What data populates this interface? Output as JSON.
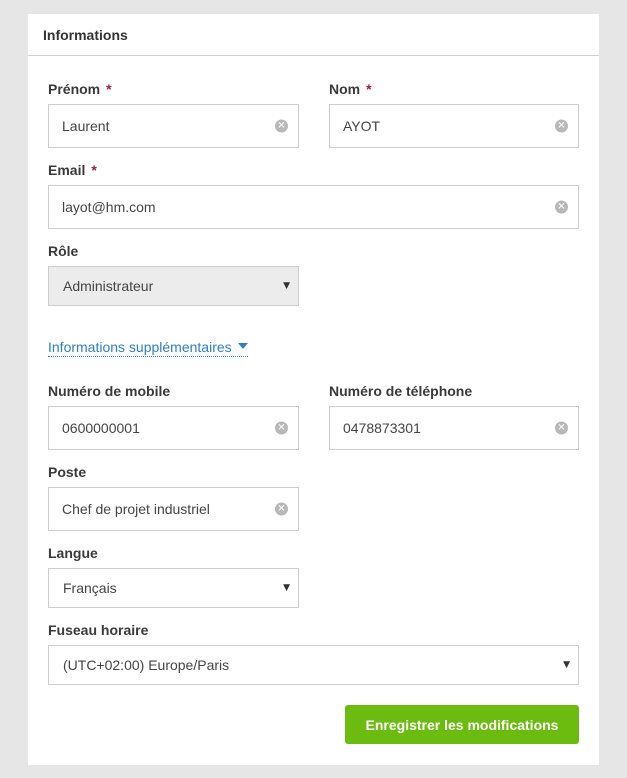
{
  "header": {
    "title": "Informations"
  },
  "required_marker": "*",
  "fields": {
    "prenom": {
      "label": "Prénom",
      "value": "Laurent"
    },
    "nom": {
      "label": "Nom",
      "value": "AYOT"
    },
    "email": {
      "label": "Email",
      "value": "layot@hm.com"
    },
    "role": {
      "label": "Rôle",
      "value": "Administrateur"
    },
    "mobile": {
      "label": "Numéro de mobile",
      "value": "0600000001"
    },
    "telephone": {
      "label": "Numéro de téléphone",
      "value": "0478873301"
    },
    "poste": {
      "label": "Poste",
      "value": "Chef de projet industriel"
    },
    "langue": {
      "label": "Langue",
      "value": "Français"
    },
    "fuseau": {
      "label": "Fuseau horaire",
      "value": "(UTC+02:00) Europe/Paris"
    }
  },
  "more_info_link": "Informations supplémentaires",
  "save_button": "Enregistrer les modifications",
  "icons": {
    "clear": "clear-circle-icon",
    "dropdown": "caret-down-icon"
  },
  "colors": {
    "accent_green": "#6cbb0f",
    "link_blue": "#2f7fc4",
    "required_red": "#a31845",
    "background": "#e6e6e6"
  }
}
